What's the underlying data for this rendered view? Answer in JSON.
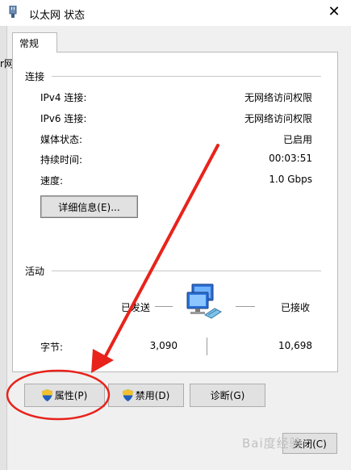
{
  "window": {
    "title": "以太网 状态"
  },
  "left_fragment": {
    "text": "r网"
  },
  "tab": {
    "label": "常规"
  },
  "connection": {
    "heading": "连接",
    "rows": [
      {
        "label": "IPv4 连接:",
        "value": "无网络访问权限"
      },
      {
        "label": "IPv6 连接:",
        "value": "无网络访问权限"
      },
      {
        "label": "媒体状态:",
        "value": "已启用"
      },
      {
        "label": "持续时间:",
        "value": "00:03:51"
      },
      {
        "label": "速度:",
        "value": "1.0 Gbps"
      }
    ],
    "details_button": "详细信息(E)..."
  },
  "activity": {
    "heading": "活动",
    "sent_label": "已发送",
    "received_label": "已接收",
    "bytes_label": "字节:",
    "bytes_sent": "3,090",
    "bytes_received": "10,698"
  },
  "buttons": {
    "properties": "属性(P)",
    "disable": "禁用(D)",
    "diagnose": "诊断(G)",
    "close": "关闭(C)"
  },
  "watermark": {
    "text": "Bai度经验"
  },
  "colors": {
    "annotation_red": "#e8231b",
    "shield_blue": "#1f5fbf",
    "shield_yellow": "#f2c12e",
    "monitor_blue": "#2a6fd6"
  }
}
